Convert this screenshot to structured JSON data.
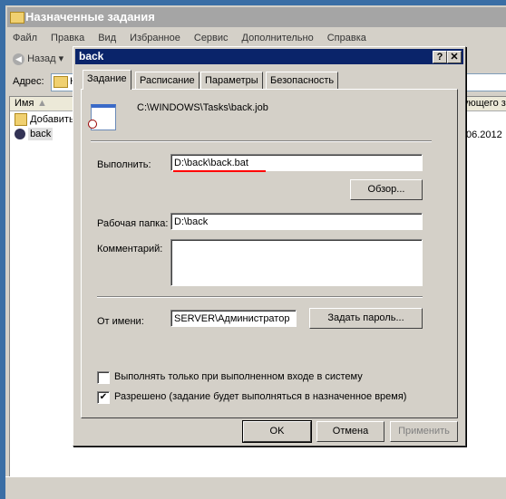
{
  "window": {
    "title": "Назначенные задания",
    "menu": [
      "Файл",
      "Правка",
      "Вид",
      "Избранное",
      "Сервис",
      "Дополнительно",
      "Справка"
    ],
    "back_label": "Назад",
    "address_label": "Адрес:",
    "address_value": "Н",
    "column_name": "Имя",
    "column_right": "ующего з",
    "items": [
      {
        "label": "Добавить"
      },
      {
        "label": "back",
        "date": "06.2012"
      }
    ]
  },
  "dialog": {
    "title": "back",
    "help": "?",
    "close": "✕",
    "tabs": [
      "Задание",
      "Расписание",
      "Параметры",
      "Безопасность"
    ],
    "job_path": "C:\\WINDOWS\\Tasks\\back.job",
    "run_label": "Выполнить:",
    "run_value": "D:\\back\\back.bat",
    "browse": "Обзор...",
    "workdir_label": "Рабочая папка:",
    "workdir_value": "D:\\back",
    "comment_label": "Комментарий:",
    "comment_value": "",
    "runas_label": "От имени:",
    "runas_value": "SERVER\\Администратор",
    "set_password": "Задать пароль...",
    "check_logon": {
      "label": "Выполнять только при выполненном входе в систему",
      "checked": false
    },
    "check_enabled": {
      "label": "Разрешено (задание будет выполняться в назначенное время)",
      "checked": true
    },
    "ok": "OK",
    "cancel": "Отмена",
    "apply": "Применить",
    "annotation_color": "#ff0000"
  }
}
